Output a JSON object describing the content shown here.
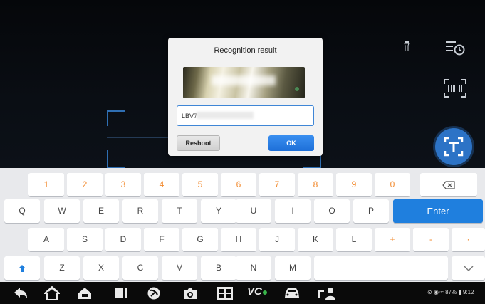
{
  "dialog": {
    "title": "Recognition result",
    "vin_value": "LBV7",
    "reshoot_label": "Reshoot",
    "ok_label": "OK"
  },
  "keyboard": {
    "row1": [
      "1",
      "2",
      "3",
      "4",
      "5",
      "6",
      "7",
      "8",
      "9",
      "0"
    ],
    "row2": [
      "Q",
      "W",
      "E",
      "R",
      "T",
      "Y",
      "U",
      "I",
      "O",
      "P"
    ],
    "enter_label": "Enter",
    "row3": [
      "A",
      "S",
      "D",
      "F",
      "G",
      "H",
      "J",
      "K",
      "L",
      "+",
      "-",
      "·"
    ],
    "row4": [
      "Z",
      "X",
      "C",
      "V",
      "B",
      "N",
      "M"
    ]
  },
  "camera_tools": {
    "torch": "flashlight-icon",
    "history": "scan-history-icon",
    "barcode": "barcode-scan-icon",
    "ocr": "text-recognition-icon"
  },
  "navbar": {
    "icons": [
      "back-icon",
      "home-icon",
      "vehicle-home-icon",
      "recent-apps-icon",
      "browser-icon",
      "camera-icon",
      "screen-record-icon",
      "vci-icon",
      "car-icon",
      "user-support-icon"
    ],
    "vci_label": "VC",
    "status": "87%",
    "time": "9:12"
  },
  "colors": {
    "accent": "#1f7fde",
    "number_keys": "#f28a2e"
  }
}
